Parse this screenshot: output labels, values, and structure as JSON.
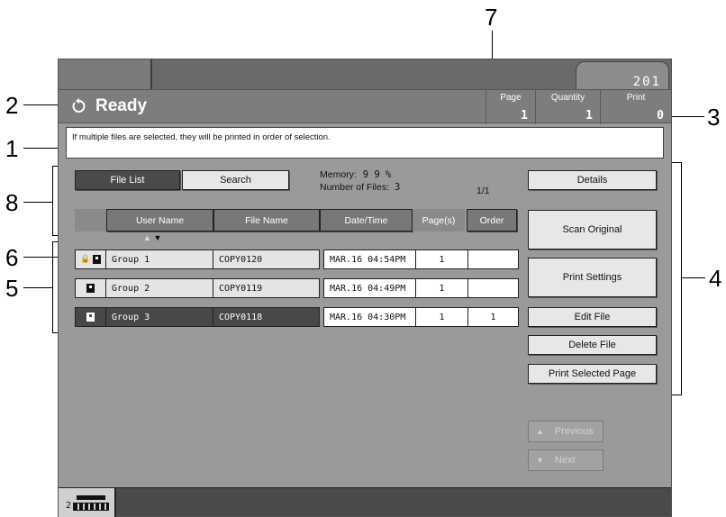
{
  "callouts": [
    "1",
    "2",
    "3",
    "4",
    "5",
    "6",
    "7",
    "8"
  ],
  "counter_tab_value": "201",
  "status": {
    "text": "Ready",
    "page_label": "Page",
    "page_value": "1",
    "quantity_label": "Quantity",
    "quantity_value": "1",
    "print_label": "Print",
    "print_value": "0"
  },
  "message": "If multiple files are selected, they will be printed in order of selection.",
  "view": {
    "file_list_label": "File List",
    "search_label": "Search"
  },
  "info": {
    "memory_label": "Memory:",
    "memory_value": "9 9 %",
    "files_label": "Number of Files:",
    "files_value": "3",
    "pagination": "1/1"
  },
  "columns": [
    "User Name",
    "File Name",
    "Date/Time",
    "Page(s)",
    "Order"
  ],
  "sort_indicator": {
    "up": "▲",
    "down": "▼"
  },
  "rows": [
    {
      "user": "Group 1",
      "file": "COPY0120",
      "datetime": "MAR.16  04:54PM",
      "pages": "1",
      "order": "",
      "locked": true,
      "selected": false
    },
    {
      "user": "Group 2",
      "file": "COPY0119",
      "datetime": "MAR.16  04:49PM",
      "pages": "1",
      "order": "",
      "locked": false,
      "selected": false
    },
    {
      "user": "Group 3",
      "file": "COPY0118",
      "datetime": "MAR.16  04:30PM",
      "pages": "1",
      "order": "1",
      "locked": false,
      "selected": true
    }
  ],
  "actions": {
    "details": "Details",
    "scan_original": "Scan Original",
    "print_settings": "Print Settings",
    "edit_file": "Edit File",
    "delete_file": "Delete File",
    "print_selected_page": "Print Selected Page",
    "previous": "Previous",
    "next": "Next"
  },
  "bottom": {
    "battery_digit": "2"
  },
  "icons": {
    "status": "rotate-ccw-icon",
    "row_doc": "document-icon",
    "row_lock": "lock-icon",
    "previous": "triangle-up-icon",
    "next": "triangle-down-icon",
    "battery": "memory-battery-icon"
  },
  "colors": {
    "frame": "#9a9a9a",
    "selected_row": "#484848",
    "button": "#e7e7e7",
    "disabled_button": "#a2a2a2"
  }
}
